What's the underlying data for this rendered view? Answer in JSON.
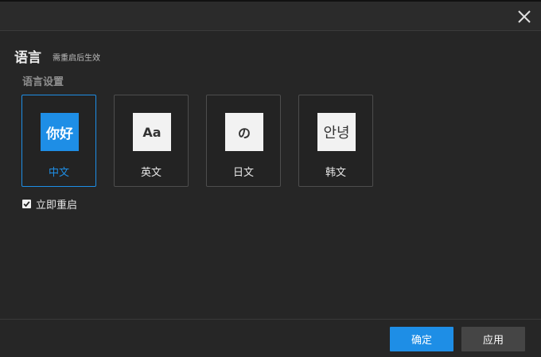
{
  "dialog": {
    "section_title": "语言",
    "section_note": "需重启后生效",
    "subsection_title": "语言设置"
  },
  "languages": [
    {
      "glyph": "你好",
      "label": "中文",
      "selected": true
    },
    {
      "glyph": "Aa",
      "label": "英文",
      "selected": false
    },
    {
      "glyph": "の",
      "label": "日文",
      "selected": false
    },
    {
      "glyph": "안녕",
      "label": "韩文",
      "selected": false
    }
  ],
  "restart_option": {
    "label": "立即重启",
    "checked": true
  },
  "buttons": {
    "confirm_label": "确定",
    "apply_label": "应用"
  },
  "icons": {
    "close": "close-icon",
    "checkbox": "check-icon"
  },
  "colors": {
    "accent": "#1e8ee6",
    "background": "#262626",
    "secondary_button": "#454545"
  }
}
